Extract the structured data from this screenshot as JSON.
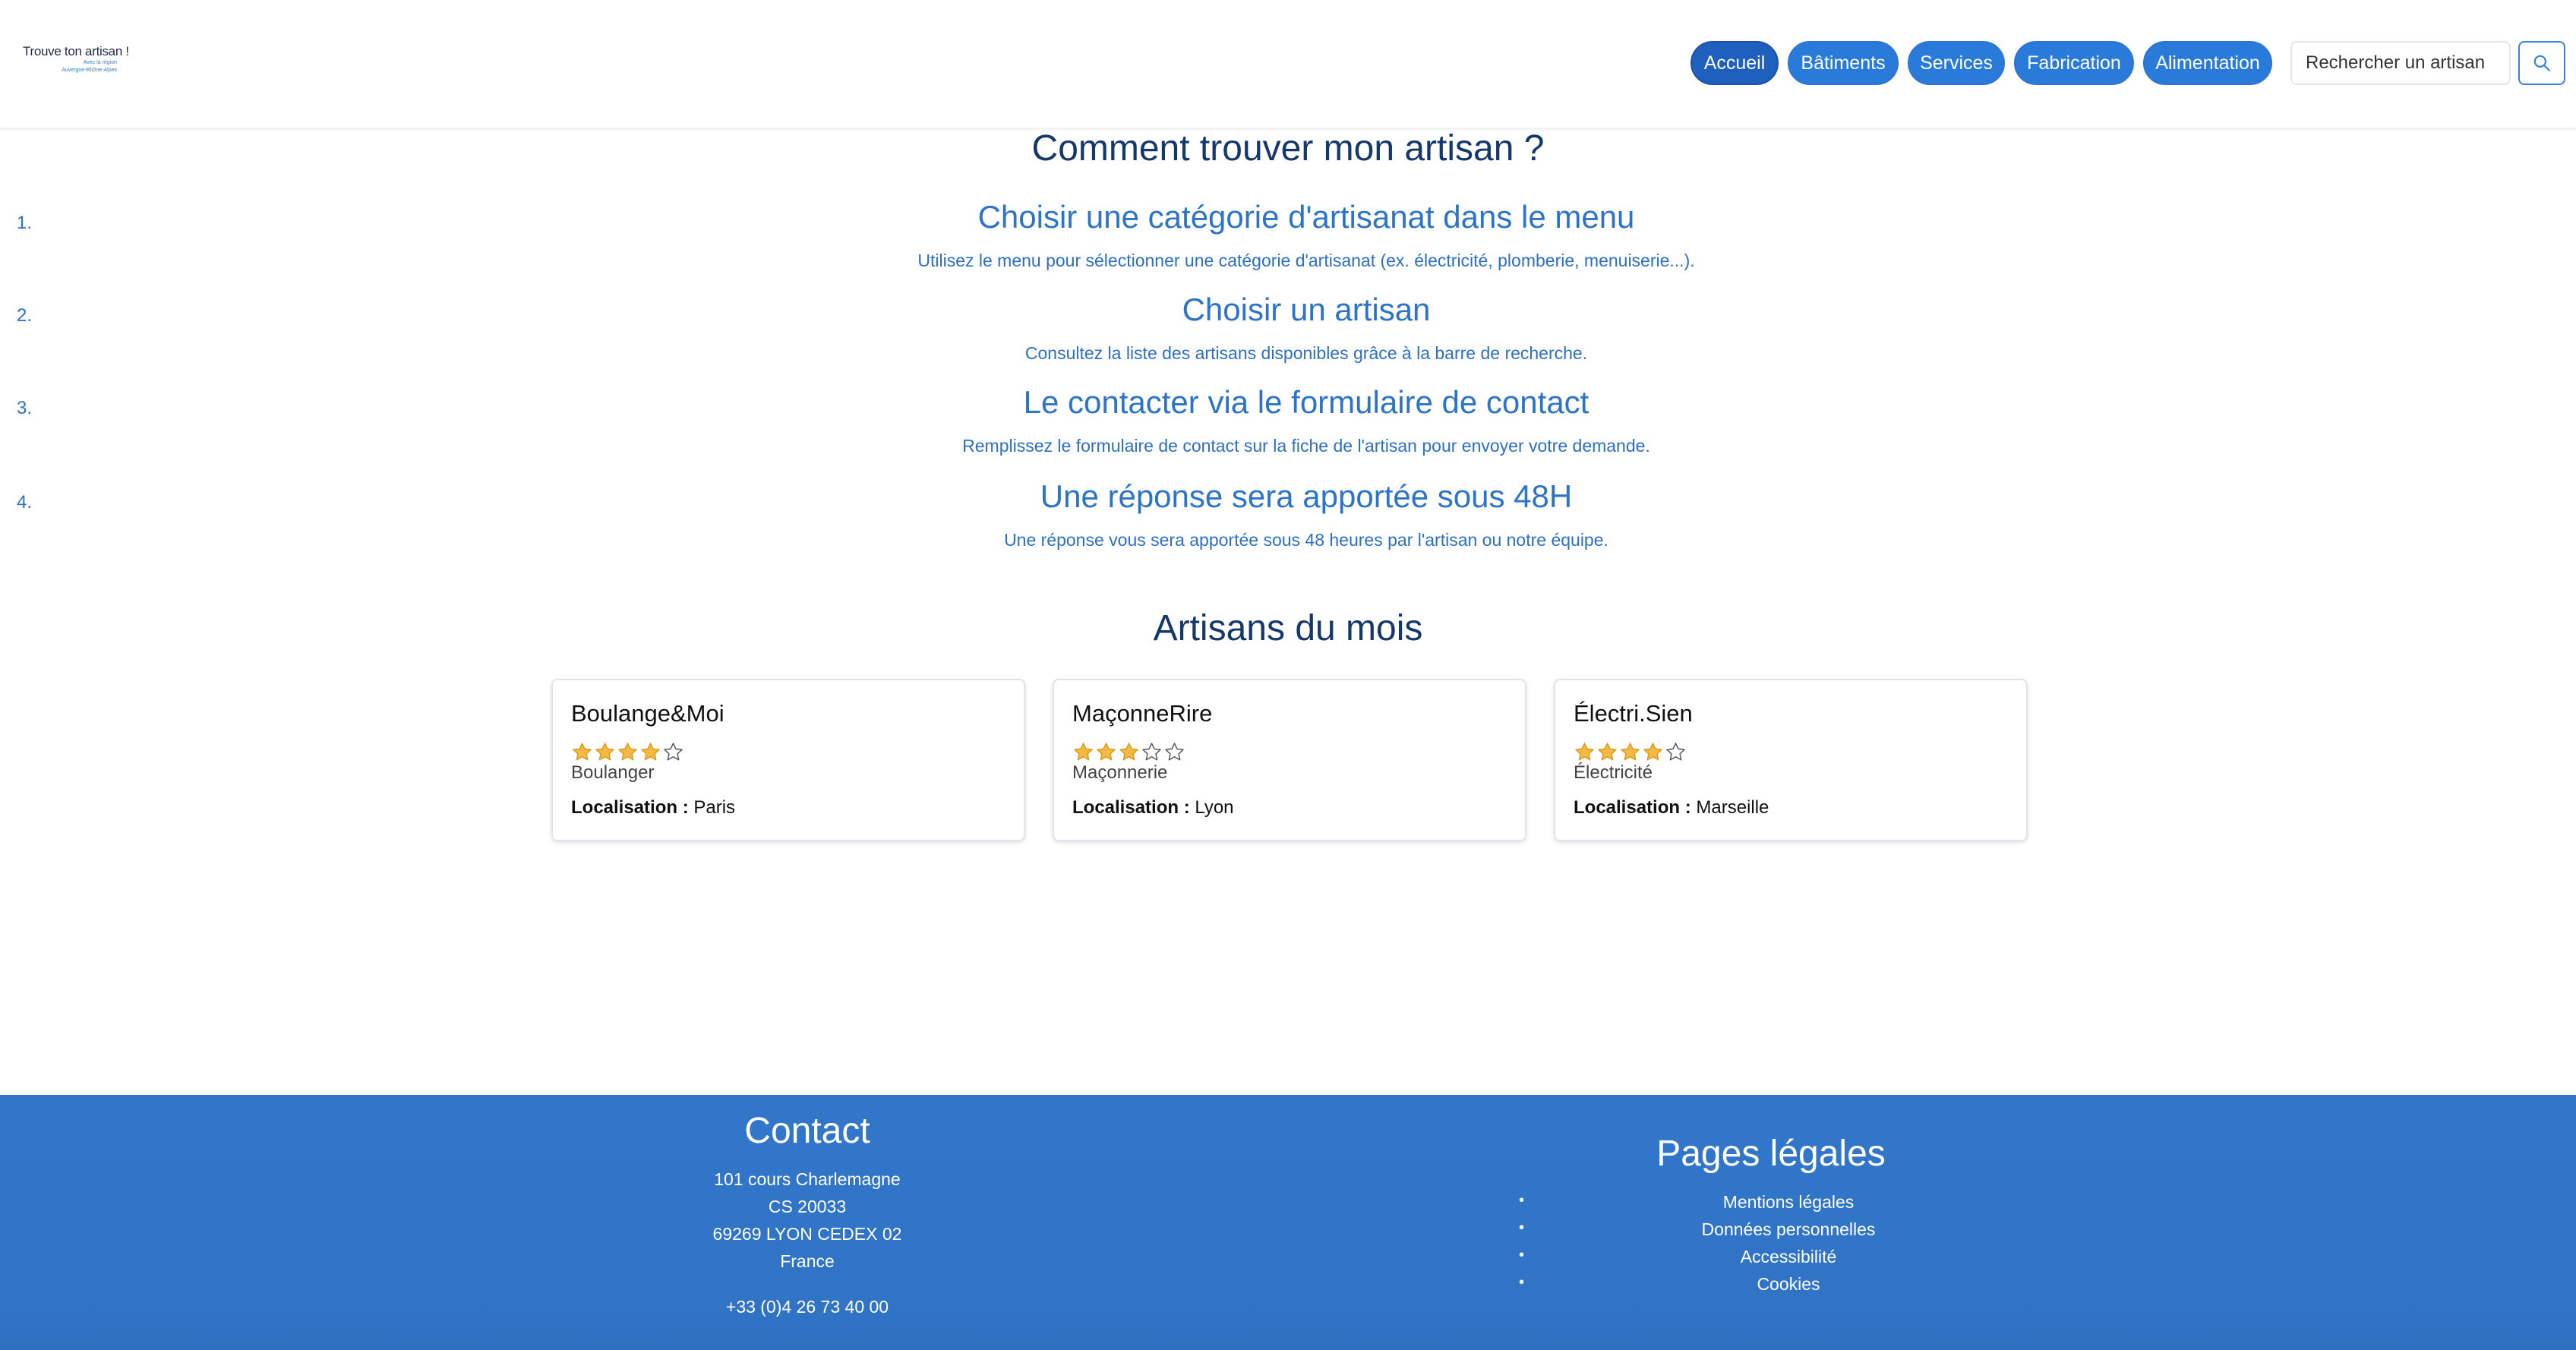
{
  "header": {
    "logo": {
      "title": "Trouve ton artisan !",
      "subtitle_line1": "Avec la région",
      "subtitle_line2": "Auvergne-Rhône-Alpes"
    },
    "nav": [
      {
        "label": "Accueil",
        "active": true
      },
      {
        "label": "Bâtiments",
        "active": false
      },
      {
        "label": "Services",
        "active": false
      },
      {
        "label": "Fabrication",
        "active": false
      },
      {
        "label": "Alimentation",
        "active": false
      }
    ],
    "search": {
      "placeholder": "Rechercher un artisan",
      "icon": "search-icon"
    }
  },
  "how_to": {
    "title": "Comment trouver mon artisan ?",
    "steps": [
      {
        "number": "1.",
        "title": "Choisir une catégorie d'artisanat dans le menu",
        "description": "Utilisez le menu pour sélectionner une catégorie d'artisanat (ex. électricité, plomberie, menuiserie...)."
      },
      {
        "number": "2.",
        "title": "Choisir un artisan",
        "description": "Consultez la liste des artisans disponibles grâce à la barre de recherche."
      },
      {
        "number": "3.",
        "title": "Le contacter via le formulaire de contact",
        "description": "Remplissez le formulaire de contact sur la fiche de l'artisan pour envoyer votre demande."
      },
      {
        "number": "4.",
        "title": "Une réponse sera apportée sous 48H",
        "description": "Une réponse vous sera apportée sous 48 heures par l'artisan ou notre équipe."
      }
    ]
  },
  "artisans": {
    "title": "Artisans du mois",
    "location_label": "Localisation :",
    "cards": [
      {
        "name": "Boulange&Moi",
        "rating": 4,
        "max_rating": 5,
        "category": "Boulanger",
        "location": "Paris"
      },
      {
        "name": "MaçonneRire",
        "rating": 3,
        "max_rating": 5,
        "category": "Maçonnerie",
        "location": "Lyon"
      },
      {
        "name": "Électri.Sien",
        "rating": 4,
        "max_rating": 5,
        "category": "Électricité",
        "location": "Marseille"
      }
    ]
  },
  "footer": {
    "contact": {
      "title": "Contact",
      "address": [
        "101 cours Charlemagne",
        "CS 20033",
        "69269 LYON CEDEX 02",
        "France"
      ],
      "phone": "+33 (0)4 26 73 40 00"
    },
    "legal": {
      "title": "Pages légales",
      "links": [
        "Mentions légales",
        "Données personnelles",
        "Accessibilité",
        "Cookies"
      ]
    }
  },
  "colors": {
    "nav_button": "#2a7bd9",
    "nav_active": "#1f5fbd",
    "heading_dark": "#15386b",
    "step_blue": "#2d73c7",
    "footer_bg": "#3176c9",
    "star_filled": "#f4b942",
    "star_empty": "#ffffff"
  }
}
